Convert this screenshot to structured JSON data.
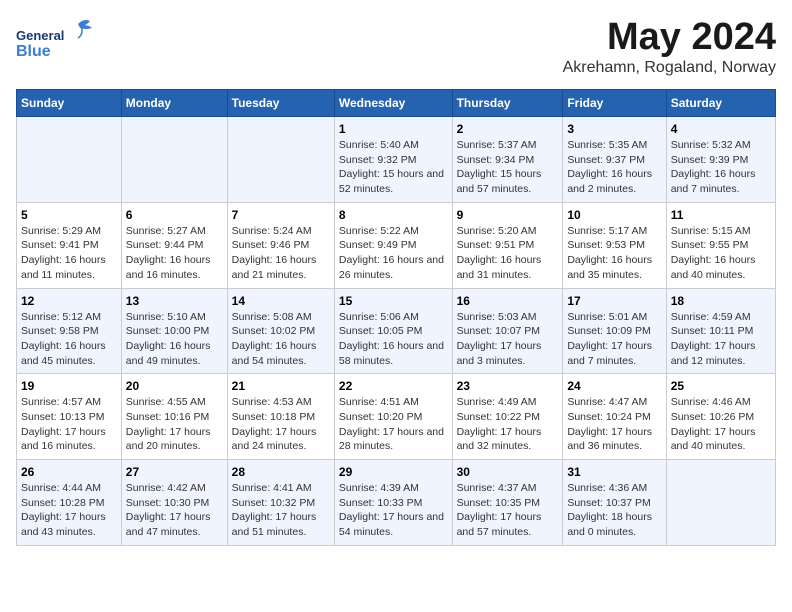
{
  "logo": {
    "line1": "General",
    "line2": "Blue"
  },
  "title": "May 2024",
  "location": "Akrehamn, Rogaland, Norway",
  "headers": [
    "Sunday",
    "Monday",
    "Tuesday",
    "Wednesday",
    "Thursday",
    "Friday",
    "Saturday"
  ],
  "weeks": [
    [
      {
        "day": "",
        "info": ""
      },
      {
        "day": "",
        "info": ""
      },
      {
        "day": "",
        "info": ""
      },
      {
        "day": "1",
        "info": "Sunrise: 5:40 AM\nSunset: 9:32 PM\nDaylight: 15 hours and 52 minutes."
      },
      {
        "day": "2",
        "info": "Sunrise: 5:37 AM\nSunset: 9:34 PM\nDaylight: 15 hours and 57 minutes."
      },
      {
        "day": "3",
        "info": "Sunrise: 5:35 AM\nSunset: 9:37 PM\nDaylight: 16 hours and 2 minutes."
      },
      {
        "day": "4",
        "info": "Sunrise: 5:32 AM\nSunset: 9:39 PM\nDaylight: 16 hours and 7 minutes."
      }
    ],
    [
      {
        "day": "5",
        "info": "Sunrise: 5:29 AM\nSunset: 9:41 PM\nDaylight: 16 hours and 11 minutes."
      },
      {
        "day": "6",
        "info": "Sunrise: 5:27 AM\nSunset: 9:44 PM\nDaylight: 16 hours and 16 minutes."
      },
      {
        "day": "7",
        "info": "Sunrise: 5:24 AM\nSunset: 9:46 PM\nDaylight: 16 hours and 21 minutes."
      },
      {
        "day": "8",
        "info": "Sunrise: 5:22 AM\nSunset: 9:49 PM\nDaylight: 16 hours and 26 minutes."
      },
      {
        "day": "9",
        "info": "Sunrise: 5:20 AM\nSunset: 9:51 PM\nDaylight: 16 hours and 31 minutes."
      },
      {
        "day": "10",
        "info": "Sunrise: 5:17 AM\nSunset: 9:53 PM\nDaylight: 16 hours and 35 minutes."
      },
      {
        "day": "11",
        "info": "Sunrise: 5:15 AM\nSunset: 9:55 PM\nDaylight: 16 hours and 40 minutes."
      }
    ],
    [
      {
        "day": "12",
        "info": "Sunrise: 5:12 AM\nSunset: 9:58 PM\nDaylight: 16 hours and 45 minutes."
      },
      {
        "day": "13",
        "info": "Sunrise: 5:10 AM\nSunset: 10:00 PM\nDaylight: 16 hours and 49 minutes."
      },
      {
        "day": "14",
        "info": "Sunrise: 5:08 AM\nSunset: 10:02 PM\nDaylight: 16 hours and 54 minutes."
      },
      {
        "day": "15",
        "info": "Sunrise: 5:06 AM\nSunset: 10:05 PM\nDaylight: 16 hours and 58 minutes."
      },
      {
        "day": "16",
        "info": "Sunrise: 5:03 AM\nSunset: 10:07 PM\nDaylight: 17 hours and 3 minutes."
      },
      {
        "day": "17",
        "info": "Sunrise: 5:01 AM\nSunset: 10:09 PM\nDaylight: 17 hours and 7 minutes."
      },
      {
        "day": "18",
        "info": "Sunrise: 4:59 AM\nSunset: 10:11 PM\nDaylight: 17 hours and 12 minutes."
      }
    ],
    [
      {
        "day": "19",
        "info": "Sunrise: 4:57 AM\nSunset: 10:13 PM\nDaylight: 17 hours and 16 minutes."
      },
      {
        "day": "20",
        "info": "Sunrise: 4:55 AM\nSunset: 10:16 PM\nDaylight: 17 hours and 20 minutes."
      },
      {
        "day": "21",
        "info": "Sunrise: 4:53 AM\nSunset: 10:18 PM\nDaylight: 17 hours and 24 minutes."
      },
      {
        "day": "22",
        "info": "Sunrise: 4:51 AM\nSunset: 10:20 PM\nDaylight: 17 hours and 28 minutes."
      },
      {
        "day": "23",
        "info": "Sunrise: 4:49 AM\nSunset: 10:22 PM\nDaylight: 17 hours and 32 minutes."
      },
      {
        "day": "24",
        "info": "Sunrise: 4:47 AM\nSunset: 10:24 PM\nDaylight: 17 hours and 36 minutes."
      },
      {
        "day": "25",
        "info": "Sunrise: 4:46 AM\nSunset: 10:26 PM\nDaylight: 17 hours and 40 minutes."
      }
    ],
    [
      {
        "day": "26",
        "info": "Sunrise: 4:44 AM\nSunset: 10:28 PM\nDaylight: 17 hours and 43 minutes."
      },
      {
        "day": "27",
        "info": "Sunrise: 4:42 AM\nSunset: 10:30 PM\nDaylight: 17 hours and 47 minutes."
      },
      {
        "day": "28",
        "info": "Sunrise: 4:41 AM\nSunset: 10:32 PM\nDaylight: 17 hours and 51 minutes."
      },
      {
        "day": "29",
        "info": "Sunrise: 4:39 AM\nSunset: 10:33 PM\nDaylight: 17 hours and 54 minutes."
      },
      {
        "day": "30",
        "info": "Sunrise: 4:37 AM\nSunset: 10:35 PM\nDaylight: 17 hours and 57 minutes."
      },
      {
        "day": "31",
        "info": "Sunrise: 4:36 AM\nSunset: 10:37 PM\nDaylight: 18 hours and 0 minutes."
      },
      {
        "day": "",
        "info": ""
      }
    ]
  ]
}
